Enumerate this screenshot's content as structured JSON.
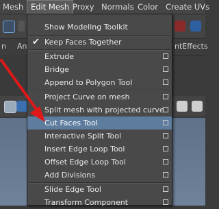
{
  "menubar": {
    "items": [
      "Mesh",
      "Edit Mesh",
      "Proxy",
      "Normals",
      "Color",
      "Create UVs"
    ]
  },
  "background": {
    "tab_partial_1": "n",
    "tab_partial_2": "An",
    "tab_partial_3": "ntEffects"
  },
  "menu": {
    "items": [
      {
        "label": "Show Modeling Toolkit",
        "option": false,
        "checked": false
      },
      {
        "label": "Keep Faces Together",
        "option": false,
        "checked": true
      },
      {
        "label": "Extrude",
        "option": true
      },
      {
        "label": "Bridge",
        "option": true
      },
      {
        "label": "Append to Polygon Tool",
        "option": true
      },
      {
        "label": "Project Curve on mesh",
        "option": true
      },
      {
        "label": "Split mesh with projected curve",
        "option": true
      },
      {
        "label": "Cut Faces Tool",
        "option": true,
        "highlighted": true
      },
      {
        "label": "Interactive Split Tool",
        "option": true
      },
      {
        "label": "Insert Edge Loop Tool",
        "option": true
      },
      {
        "label": "Offset Edge Loop Tool",
        "option": true
      },
      {
        "label": "Add Divisions",
        "option": true
      },
      {
        "label": "Slide Edge Tool",
        "option": true
      },
      {
        "label": "Transform Component",
        "option": true
      }
    ]
  },
  "colors": {
    "highlight": "#5d7c9e",
    "arrow": "#e01818",
    "menu_bg": "#494949"
  }
}
